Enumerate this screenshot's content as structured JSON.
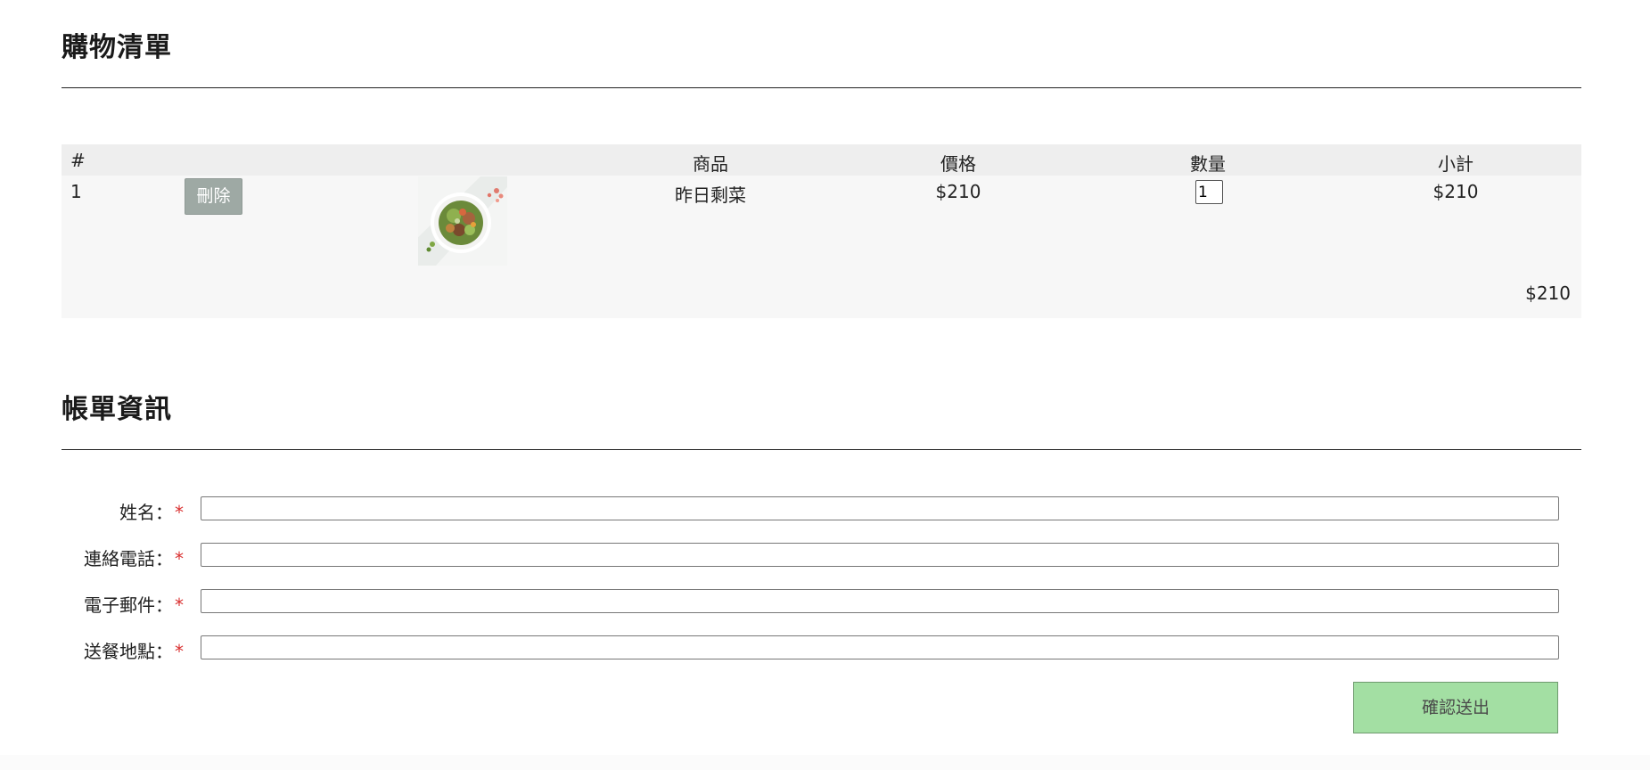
{
  "cart": {
    "title": "購物清單",
    "columns": [
      "#",
      "商品",
      "價格",
      "數量",
      "小計"
    ],
    "items": [
      {
        "index": "1",
        "delete_label": "刪除",
        "image": "salad-bowl-image",
        "name": "昨日剩菜",
        "price": "$210",
        "quantity": "1",
        "subtotal": "$210"
      }
    ],
    "total": "$210"
  },
  "billing": {
    "title": "帳單資訊",
    "required_mark": "*",
    "fields": [
      {
        "label": "姓名：",
        "value": ""
      },
      {
        "label": "連絡電話：",
        "value": ""
      },
      {
        "label": "電子郵件：",
        "value": ""
      },
      {
        "label": "送餐地點：",
        "value": ""
      }
    ],
    "submit_label": "確認送出"
  },
  "colors": {
    "submit_bg": "#a3dfa3",
    "delete_bg": "#9ea9a4",
    "required": "#d93030"
  }
}
